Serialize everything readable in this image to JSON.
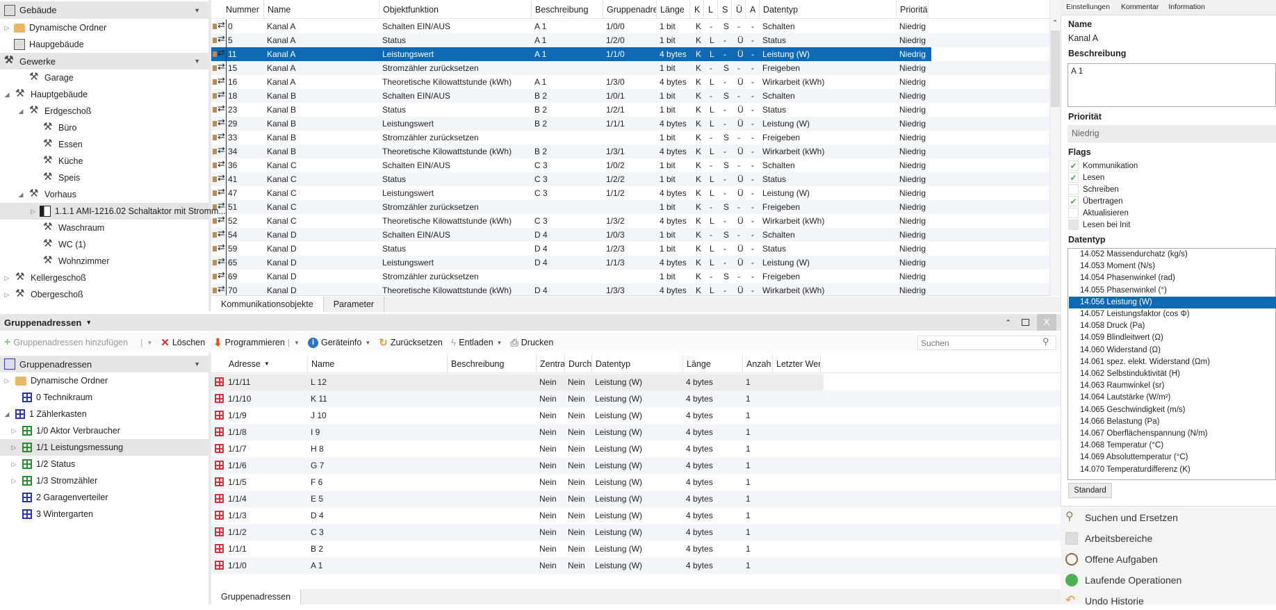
{
  "building_panel": {
    "title": "Gebäude",
    "items": [
      {
        "label": "Dynamische Ordner",
        "icon": "folder-icon",
        "expander": true
      },
      {
        "label": "Haupgebäude",
        "icon": "building-icon",
        "expander": false
      }
    ]
  },
  "trades_panel": {
    "title": "Gewerke",
    "items": [
      {
        "label": "Garage",
        "level": 1,
        "exp": ""
      },
      {
        "label": "Hauptgebäude",
        "level": 0,
        "exp": "open"
      },
      {
        "label": "Erdgeschoß",
        "level": 1,
        "exp": "open"
      },
      {
        "label": "Büro",
        "level": 2,
        "exp": ""
      },
      {
        "label": "Essen",
        "level": 2,
        "exp": ""
      },
      {
        "label": "Küche",
        "level": 2,
        "exp": ""
      },
      {
        "label": "Speis",
        "level": 2,
        "exp": ""
      },
      {
        "label": "Vorhaus",
        "level": 1,
        "exp": "open"
      },
      {
        "label": "1.1.1 AMI-1216.02 Schaltaktor mit Stromm...",
        "level": 2,
        "exp": "closed",
        "device": true,
        "selected": true
      },
      {
        "label": "Waschraum",
        "level": 2,
        "exp": ""
      },
      {
        "label": "WC (1)",
        "level": 2,
        "exp": ""
      },
      {
        "label": "Wohnzimmer",
        "level": 2,
        "exp": ""
      },
      {
        "label": "Kellergeschoß",
        "level": 0,
        "exp": "closed"
      },
      {
        "label": "Obergeschoß",
        "level": 0,
        "exp": "closed"
      }
    ]
  },
  "objects_table": {
    "columns": [
      "Nummer",
      "Name",
      "Objektfunktion",
      "Beschreibung",
      "Gruppenadres",
      "Länge",
      "K",
      "L",
      "S",
      "Ü",
      "A",
      "Datentyp",
      "Priorität"
    ],
    "rows": [
      [
        "0",
        "Kanal A",
        "Schalten EIN/AUS",
        "A 1",
        "1/0/0",
        "1 bit",
        "K",
        "-",
        "S",
        "-",
        "-",
        "Schalten",
        "Niedrig"
      ],
      [
        "5",
        "Kanal A",
        "Status",
        "A 1",
        "1/2/0",
        "1 bit",
        "K",
        "L",
        "-",
        "Ü",
        "-",
        "Status",
        "Niedrig"
      ],
      [
        "11",
        "Kanal A",
        "Leistungswert",
        "A 1",
        "1/1/0",
        "4 bytes",
        "K",
        "L",
        "-",
        "Ü",
        "-",
        "Leistung (W)",
        "Niedrig"
      ],
      [
        "15",
        "Kanal A",
        "Stromzähler zurücksetzen",
        "",
        "",
        "1 bit",
        "K",
        "-",
        "S",
        "-",
        "-",
        "Freigeben",
        "Niedrig"
      ],
      [
        "16",
        "Kanal A",
        "Theoretische Kilowattstunde (kWh)",
        "A 1",
        "1/3/0",
        "4 bytes",
        "K",
        "L",
        "-",
        "Ü",
        "-",
        "Wirkarbeit (kWh)",
        "Niedrig"
      ],
      [
        "18",
        "Kanal B",
        "Schalten EIN/AUS",
        "B 2",
        "1/0/1",
        "1 bit",
        "K",
        "-",
        "S",
        "-",
        "-",
        "Schalten",
        "Niedrig"
      ],
      [
        "23",
        "Kanal B",
        "Status",
        "B 2",
        "1/2/1",
        "1 bit",
        "K",
        "L",
        "-",
        "Ü",
        "-",
        "Status",
        "Niedrig"
      ],
      [
        "29",
        "Kanal B",
        "Leistungswert",
        "B 2",
        "1/1/1",
        "4 bytes",
        "K",
        "L",
        "-",
        "Ü",
        "-",
        "Leistung (W)",
        "Niedrig"
      ],
      [
        "33",
        "Kanal B",
        "Stromzähler zurücksetzen",
        "",
        "",
        "1 bit",
        "K",
        "-",
        "S",
        "-",
        "-",
        "Freigeben",
        "Niedrig"
      ],
      [
        "34",
        "Kanal B",
        "Theoretische Kilowattstunde (kWh)",
        "B 2",
        "1/3/1",
        "4 bytes",
        "K",
        "L",
        "-",
        "Ü",
        "-",
        "Wirkarbeit (kWh)",
        "Niedrig"
      ],
      [
        "36",
        "Kanal C",
        "Schalten EIN/AUS",
        "C 3",
        "1/0/2",
        "1 bit",
        "K",
        "-",
        "S",
        "-",
        "-",
        "Schalten",
        "Niedrig"
      ],
      [
        "41",
        "Kanal C",
        "Status",
        "C 3",
        "1/2/2",
        "1 bit",
        "K",
        "L",
        "-",
        "Ü",
        "-",
        "Status",
        "Niedrig"
      ],
      [
        "47",
        "Kanal C",
        "Leistungswert",
        "C 3",
        "1/1/2",
        "4 bytes",
        "K",
        "L",
        "-",
        "Ü",
        "-",
        "Leistung (W)",
        "Niedrig"
      ],
      [
        "51",
        "Kanal C",
        "Stromzähler zurücksetzen",
        "",
        "",
        "1 bit",
        "K",
        "-",
        "S",
        "-",
        "-",
        "Freigeben",
        "Niedrig"
      ],
      [
        "52",
        "Kanal C",
        "Theoretische Kilowattstunde (kWh)",
        "C 3",
        "1/3/2",
        "4 bytes",
        "K",
        "L",
        "-",
        "Ü",
        "-",
        "Wirkarbeit (kWh)",
        "Niedrig"
      ],
      [
        "54",
        "Kanal D",
        "Schalten EIN/AUS",
        "D 4",
        "1/0/3",
        "1 bit",
        "K",
        "-",
        "S",
        "-",
        "-",
        "Schalten",
        "Niedrig"
      ],
      [
        "59",
        "Kanal D",
        "Status",
        "D 4",
        "1/2/3",
        "1 bit",
        "K",
        "L",
        "-",
        "Ü",
        "-",
        "Status",
        "Niedrig"
      ],
      [
        "65",
        "Kanal D",
        "Leistungswert",
        "D 4",
        "1/1/3",
        "4 bytes",
        "K",
        "L",
        "-",
        "Ü",
        "-",
        "Leistung (W)",
        "Niedrig"
      ],
      [
        "69",
        "Kanal D",
        "Stromzähler zurücksetzen",
        "",
        "",
        "1 bit",
        "K",
        "-",
        "S",
        "-",
        "-",
        "Freigeben",
        "Niedrig"
      ],
      [
        "70",
        "Kanal D",
        "Theoretische Kilowattstunde (kWh)",
        "D 4",
        "1/3/3",
        "4 bytes",
        "K",
        "L",
        "-",
        "Ü",
        "-",
        "Wirkarbeit (kWh)",
        "Niedrig"
      ]
    ],
    "selected_index": 2,
    "tabs": [
      "Kommunikationsobjekte",
      "Parameter"
    ]
  },
  "properties": {
    "tabs": [
      "Einstellungen",
      "Kommentar",
      "Information"
    ],
    "name_label": "Name",
    "name_value": "Kanal A",
    "desc_label": "Beschreibung",
    "desc_value": "A 1",
    "priority_label": "Priorität",
    "priority_value": "Niedrig",
    "flags_label": "Flags",
    "flags": [
      {
        "label": "Kommunikation",
        "checked": true
      },
      {
        "label": "Lesen",
        "checked": true
      },
      {
        "label": "Schreiben",
        "checked": false
      },
      {
        "label": "Übertragen",
        "checked": true
      },
      {
        "label": "Aktualisieren",
        "checked": false
      },
      {
        "label": "Lesen bei Init",
        "checked": false,
        "disabled": true
      }
    ],
    "datatype_label": "Datentyp",
    "datatypes": [
      "14.052 Massendurchatz (kg/s)",
      "14.053 Moment (N/s)",
      "14.054 Phasenwinkel (rad)",
      "14.055 Phasenwinkel (°)",
      "14.056 Leistung (W)",
      "14.057 Leistungsfaktor (cos Φ)",
      "14.058 Druck (Pa)",
      "14.059 Blindleitwert (Ω)",
      "14.060 Widerstand (Ω)",
      "14.061 spez. elekt. Widerstand (Ωm)",
      "14.062 Selbstinduktivität (H)",
      "14.063 Raumwinkel (sr)",
      "14.064 Lautstärke (W/m²)",
      "14.065 Geschwindigkeit (m/s)",
      "14.066 Belastung (Pa)",
      "14.067 Oberflächenspannung (N/m)",
      "14.068 Temperatur (°C)",
      "14.069 Absoluttemperatur (°C)",
      "14.070 Temperaturdifferenz (K)"
    ],
    "datatype_selected": 4,
    "standard_button": "Standard"
  },
  "side_links": [
    {
      "label": "Suchen und Ersetzen",
      "icon": "search-icon"
    },
    {
      "label": "Arbeitsbereiche",
      "icon": "workspace-icon"
    },
    {
      "label": "Offene Aufgaben",
      "icon": "clock-icon"
    },
    {
      "label": "Laufende Operationen",
      "icon": "play-icon"
    },
    {
      "label": "Undo Historie",
      "icon": "undo-icon"
    }
  ],
  "ga_panel": {
    "title": "Gruppenadressen",
    "toolbar": {
      "add": "Gruppenadressen hinzufügen",
      "delete": "Löschen",
      "program": "Programmieren",
      "info": "Geräteinfo",
      "reset": "Zurücksetzen",
      "unload": "Entladen",
      "print": "Drucken",
      "search_placeholder": "Suchen"
    },
    "tree_title": "Gruppenadressen",
    "tree": [
      {
        "label": "Dynamische Ordner",
        "icon": "folder",
        "level": 0,
        "exp": "closed"
      },
      {
        "label": "0 Technikraum",
        "icon": "blue",
        "level": 1,
        "exp": ""
      },
      {
        "label": "1 Zählerkasten",
        "icon": "blue",
        "level": 0,
        "exp": "open"
      },
      {
        "label": "1/0 Aktor Verbraucher",
        "icon": "green",
        "level": 1,
        "exp": "closed"
      },
      {
        "label": "1/1 Leistungsmessung",
        "icon": "green",
        "level": 1,
        "exp": "closed",
        "selected": true
      },
      {
        "label": "1/2 Status",
        "icon": "green",
        "level": 1,
        "exp": "closed"
      },
      {
        "label": "1/3 Stromzähler",
        "icon": "green",
        "level": 1,
        "exp": "closed"
      },
      {
        "label": "2 Garagenverteiler",
        "icon": "blue",
        "level": 1,
        "exp": ""
      },
      {
        "label": "3 Wintergarten",
        "icon": "blue",
        "level": 1,
        "exp": ""
      }
    ],
    "columns": [
      "Adresse",
      "Name",
      "Beschreibung",
      "Zentra",
      "Durch",
      "Datentyp",
      "Länge",
      "Anzah",
      "Letzter Wert"
    ],
    "rows": [
      [
        "1/1/11",
        "L 12",
        "",
        "Nein",
        "Nein",
        "Leistung (W)",
        "4 bytes",
        "1",
        ""
      ],
      [
        "1/1/10",
        "K 11",
        "",
        "Nein",
        "Nein",
        "Leistung (W)",
        "4 bytes",
        "1",
        ""
      ],
      [
        "1/1/9",
        "J 10",
        "",
        "Nein",
        "Nein",
        "Leistung (W)",
        "4 bytes",
        "1",
        ""
      ],
      [
        "1/1/8",
        "I 9",
        "",
        "Nein",
        "Nein",
        "Leistung (W)",
        "4 bytes",
        "1",
        ""
      ],
      [
        "1/1/7",
        "H 8",
        "",
        "Nein",
        "Nein",
        "Leistung (W)",
        "4 bytes",
        "1",
        ""
      ],
      [
        "1/1/6",
        "G 7",
        "",
        "Nein",
        "Nein",
        "Leistung (W)",
        "4 bytes",
        "1",
        ""
      ],
      [
        "1/1/5",
        "F 6",
        "",
        "Nein",
        "Nein",
        "Leistung (W)",
        "4 bytes",
        "1",
        ""
      ],
      [
        "1/1/4",
        "E 5",
        "",
        "Nein",
        "Nein",
        "Leistung (W)",
        "4 bytes",
        "1",
        ""
      ],
      [
        "1/1/3",
        "D 4",
        "",
        "Nein",
        "Nein",
        "Leistung (W)",
        "4 bytes",
        "1",
        ""
      ],
      [
        "1/1/2",
        "C 3",
        "",
        "Nein",
        "Nein",
        "Leistung (W)",
        "4 bytes",
        "1",
        ""
      ],
      [
        "1/1/1",
        "B 2",
        "",
        "Nein",
        "Nein",
        "Leistung (W)",
        "4 bytes",
        "1",
        ""
      ],
      [
        "1/1/0",
        "A 1",
        "",
        "Nein",
        "Nein",
        "Leistung (W)",
        "4 bytes",
        "1",
        ""
      ]
    ],
    "bottom_tab": "Gruppenadressen"
  },
  "colors": {
    "selection": "#0f69b4",
    "alt_row": "#f2f5f9",
    "panel_header": "#e6e6e6"
  }
}
